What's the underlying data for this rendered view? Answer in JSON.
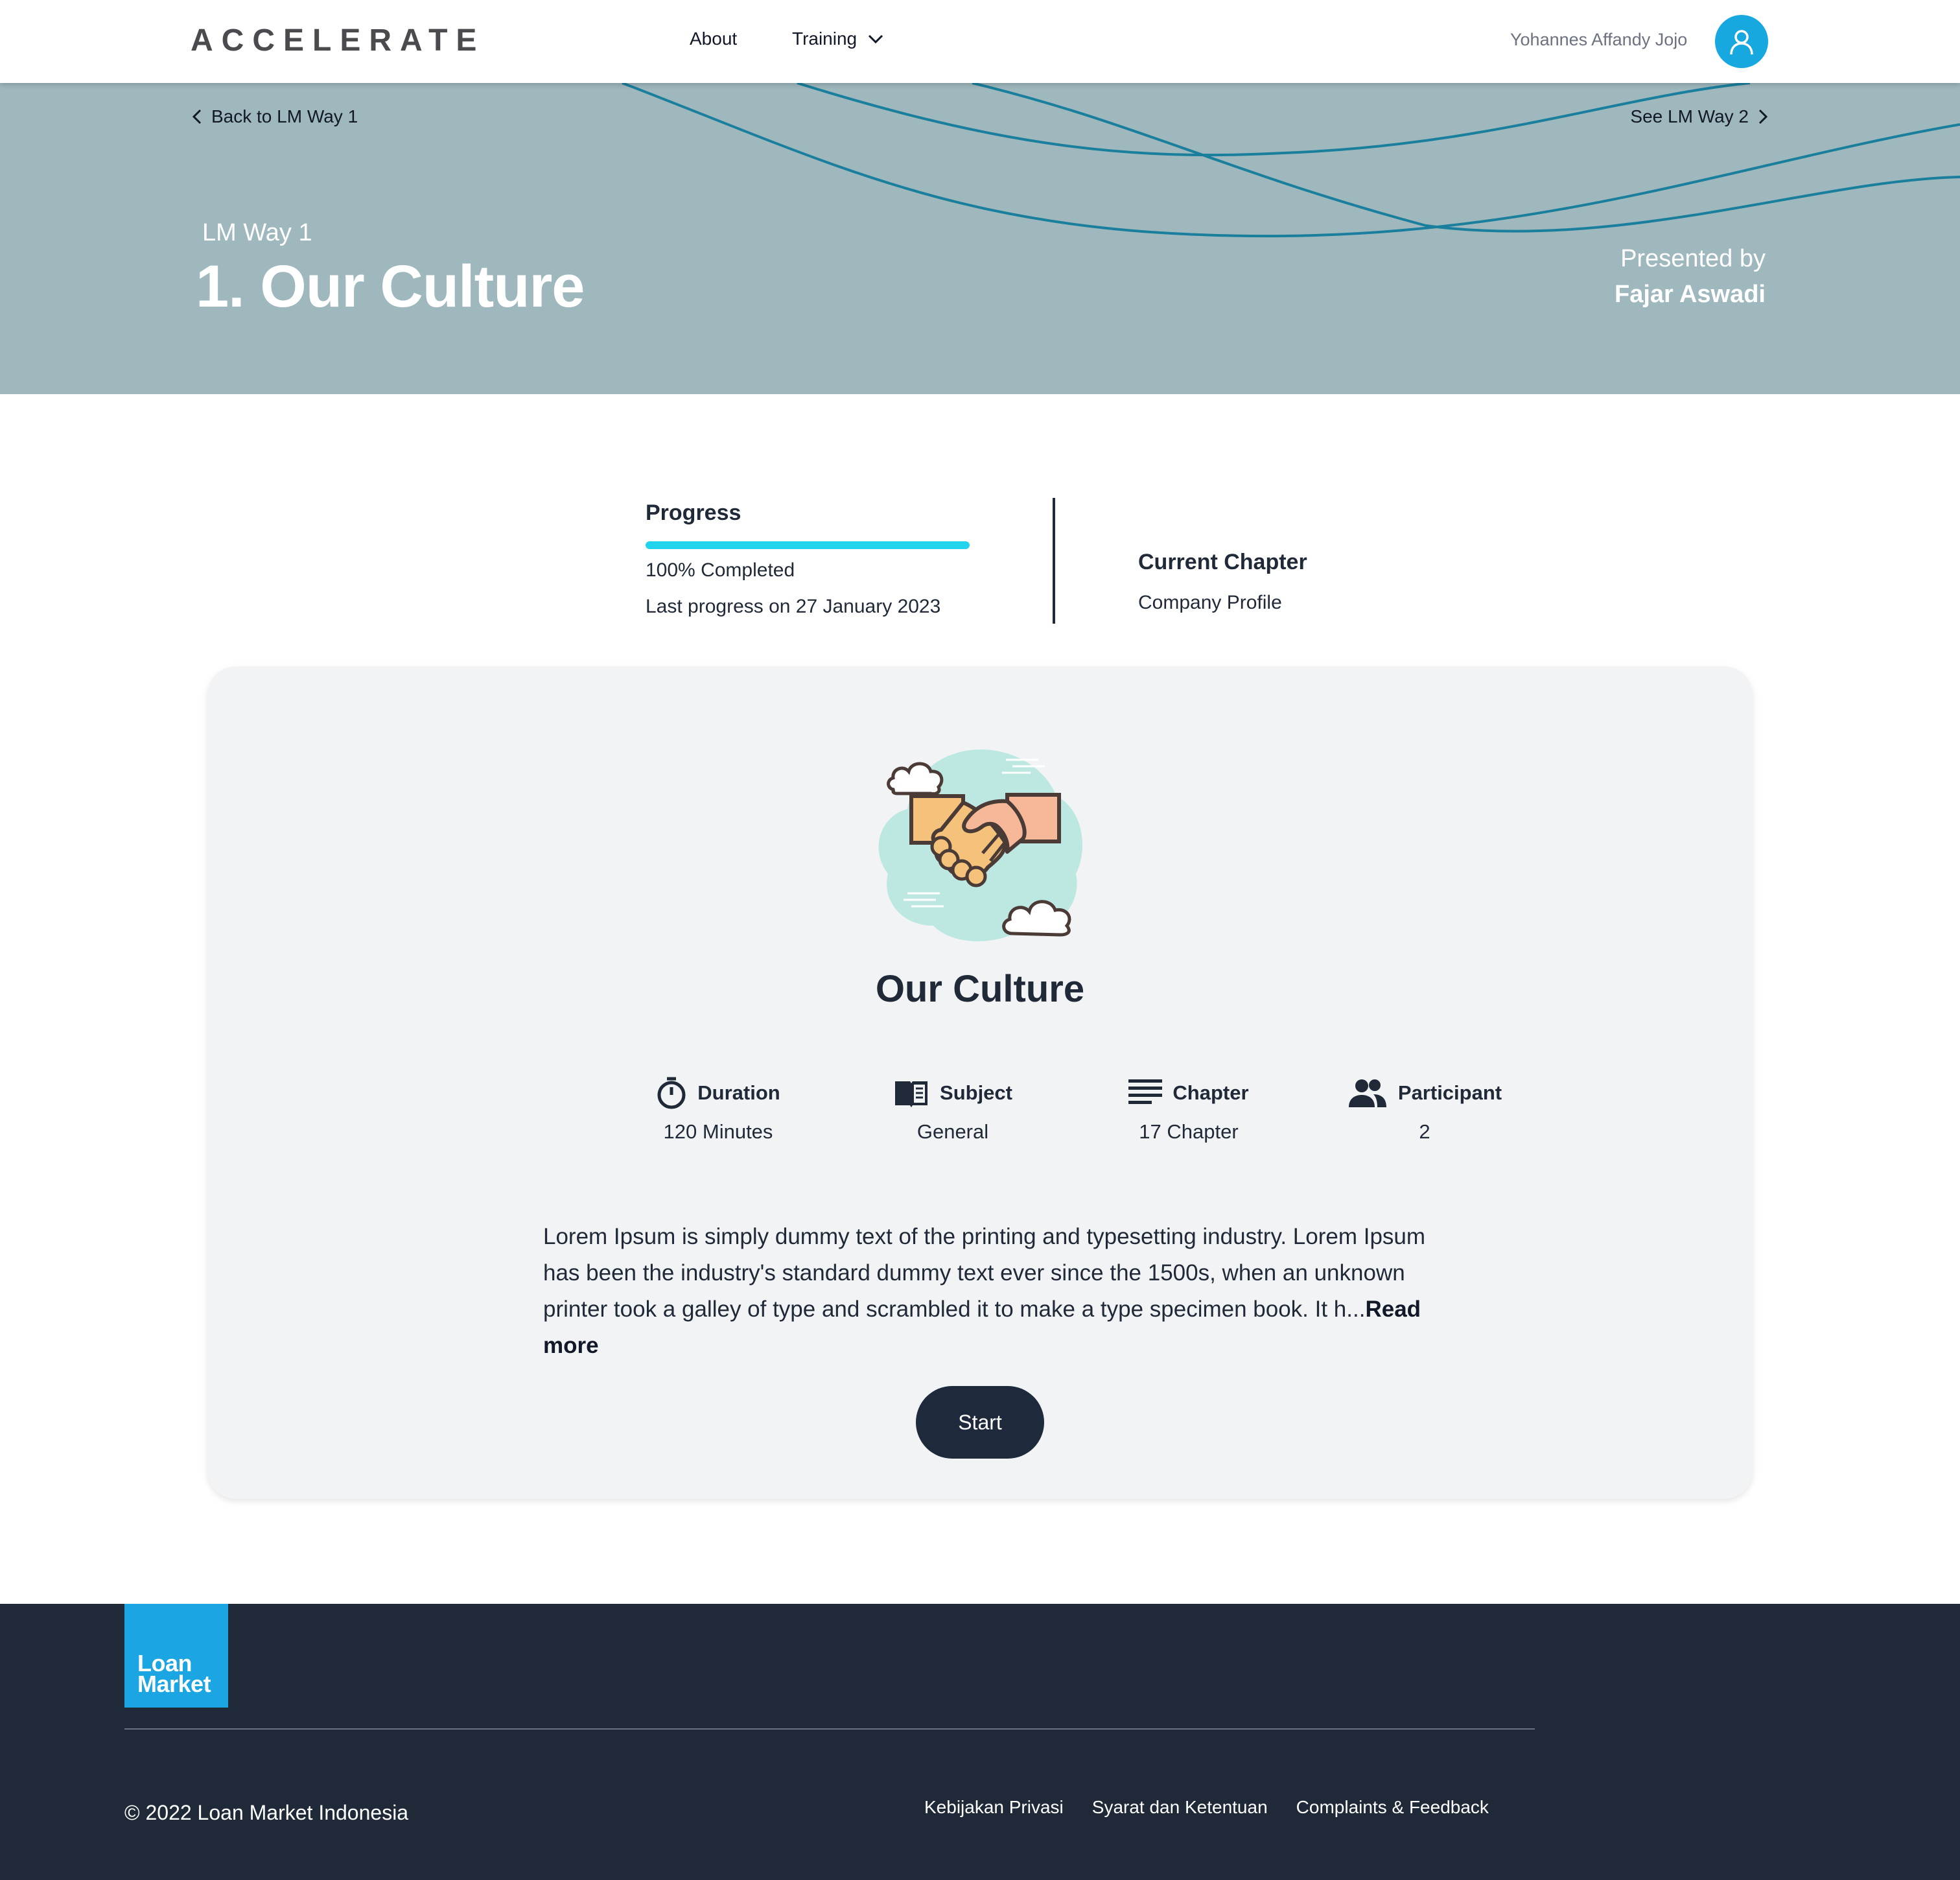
{
  "brand": {
    "logo_text": "ACCELERATE",
    "accent_color": "#18a8e0"
  },
  "nav": {
    "about": "About",
    "training": "Training"
  },
  "user": {
    "name": "Yohannes Affandy Jojo"
  },
  "hero": {
    "back_label": "Back to LM Way 1",
    "next_label": "See LM Way 2",
    "subtitle": "LM Way 1",
    "title": "1. Our Culture",
    "presented_label": "Presented by",
    "presenter": "Fajar Aswadi"
  },
  "progress": {
    "title": "Progress",
    "percent": 100,
    "completed_text": "100% Completed",
    "last_progress": "Last progress on 27 January 2023"
  },
  "current_chapter": {
    "title": "Current Chapter",
    "value": "Company Profile"
  },
  "course": {
    "title": "Our Culture",
    "stats": [
      {
        "icon": "stopwatch-icon",
        "label": "Duration",
        "value": "120 Minutes"
      },
      {
        "icon": "book-icon",
        "label": "Subject",
        "value": "General"
      },
      {
        "icon": "list-icon",
        "label": "Chapter",
        "value": "17 Chapter"
      },
      {
        "icon": "people-icon",
        "label": "Participant",
        "value": "2"
      }
    ],
    "description": "Lorem Ipsum is simply dummy text of the printing and typesetting industry. Lorem Ipsum has been the industry's standard dummy text ever since the 1500s, when an unknown printer took a galley of type and scrambled it to make a type specimen book. It h...",
    "read_more": "Read more",
    "start_label": "Start"
  },
  "footer": {
    "logo_line1": "Loan",
    "logo_line2": "Market",
    "copyright": "© 2022 Loan Market Indonesia",
    "links": [
      "Kebijakan Privasi",
      "Syarat dan Ketentuan",
      "Complaints & Feedback"
    ]
  }
}
